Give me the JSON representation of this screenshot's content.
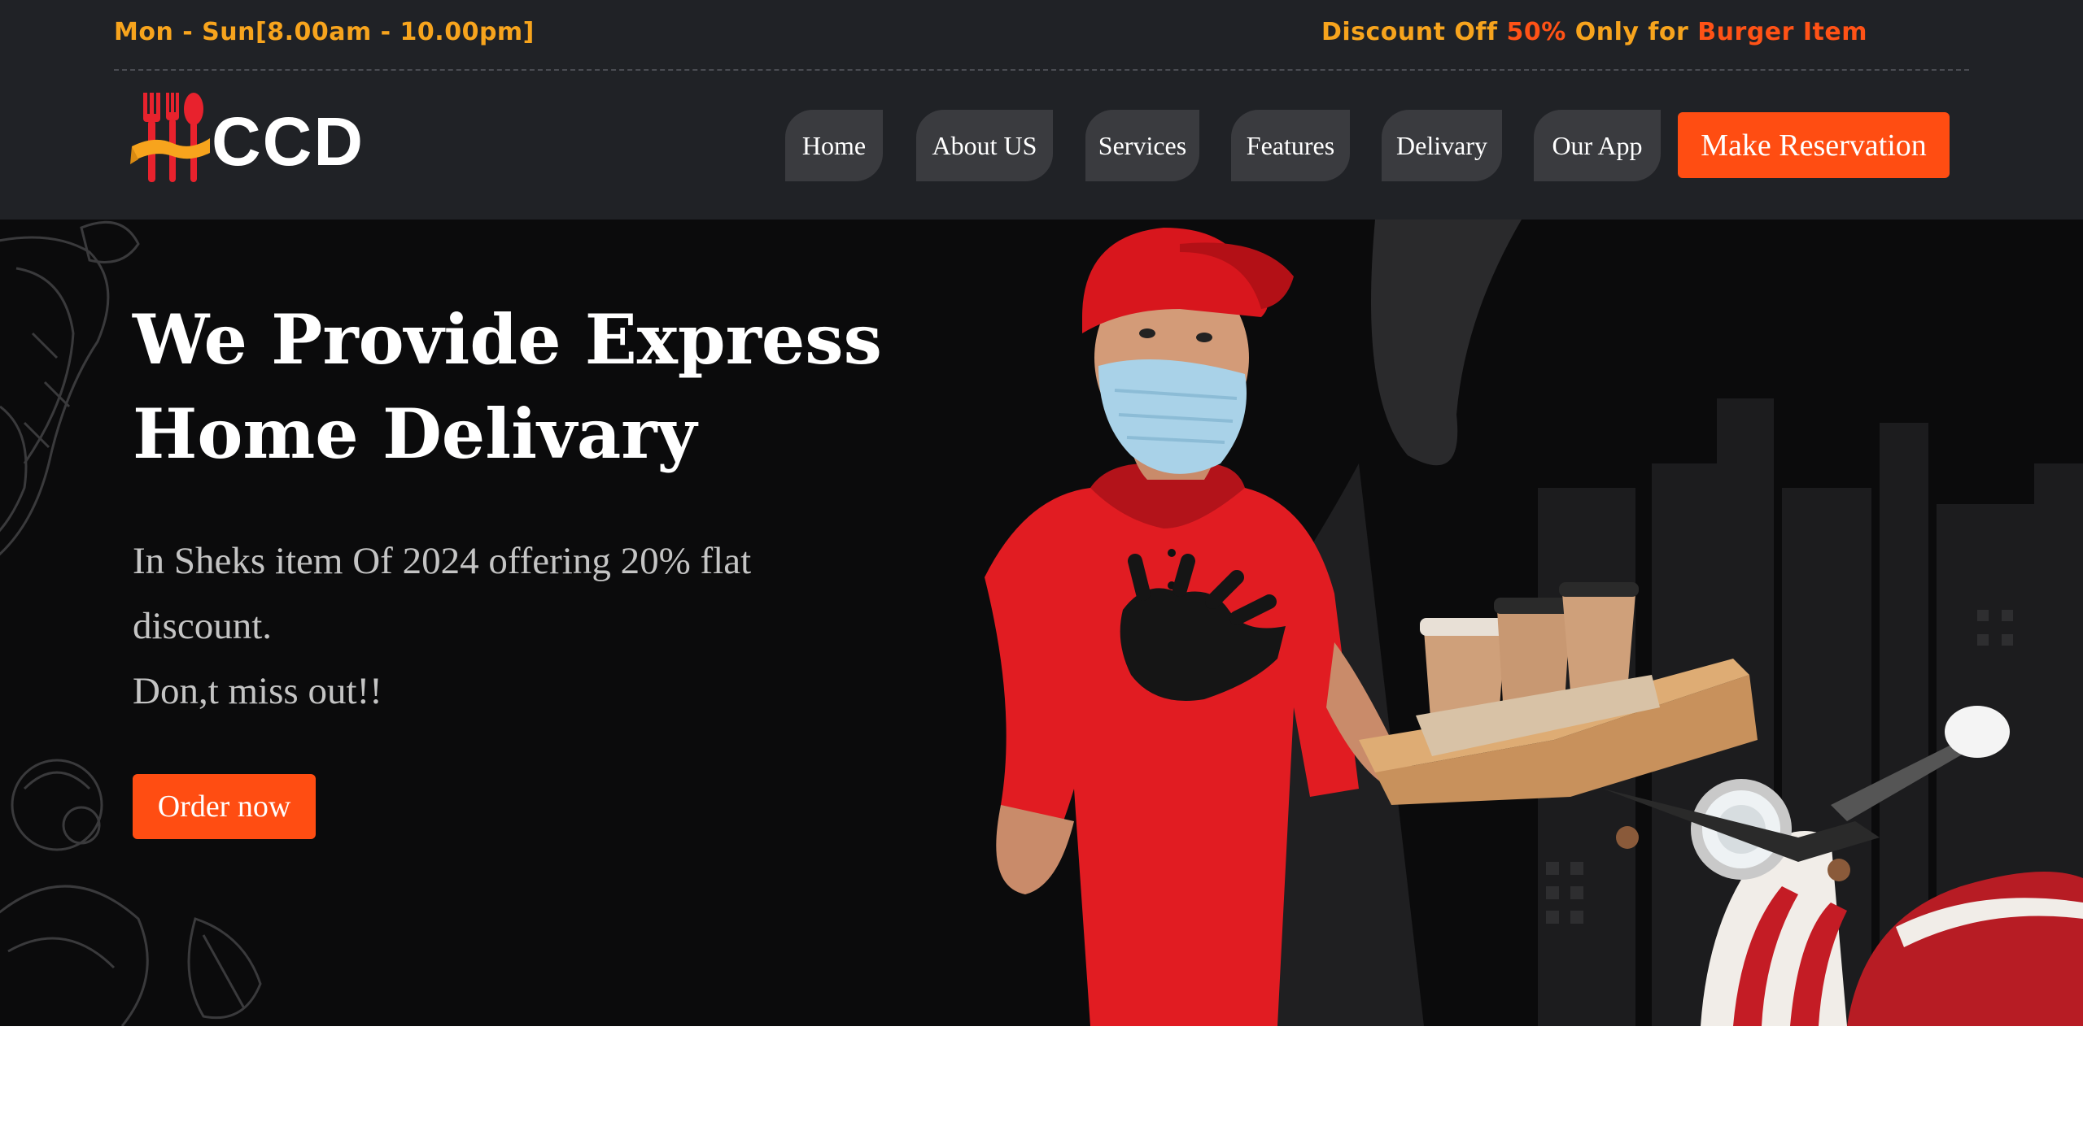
{
  "topbar": {
    "hours": "Mon - Sun[8.00am - 10.00pm]",
    "promo_prefix": "Discount Off ",
    "promo_percent": "50%",
    "promo_middle": " Only for ",
    "promo_item": "Burger Item"
  },
  "brand": {
    "logo_text": "CCD"
  },
  "nav": {
    "items": [
      "Home",
      "About US",
      "Services",
      "Features",
      "Delivary",
      "Our App"
    ],
    "cta": "Make Reservation"
  },
  "hero": {
    "title_line1": "We Provide Express",
    "title_line2": "Home Delivary",
    "sub_line1": "In Sheks item Of 2024 offering 20% flat",
    "sub_line2": "discount.",
    "sub_line3": "Don,t miss out!!",
    "cta": "Order now"
  },
  "colors": {
    "bg_dark": "#202226",
    "hero_bg": "#0b0b0c",
    "accent_orange": "#ff4d12",
    "gold": "#f7a41d",
    "nav_pill": "#3a3b3f"
  },
  "icons": [
    "fork-spoon-logo-icon",
    "delivery-man-image",
    "scooter-image",
    "food-doodle-decoration"
  ]
}
